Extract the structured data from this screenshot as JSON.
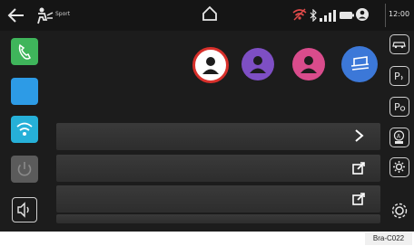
{
  "status_bar": {
    "drive_mode_label": "Sport",
    "time": "12:00",
    "icons": [
      "back-arrow-icon",
      "drive-mode-icon",
      "home-icon",
      "wifi-warning-icon",
      "bluetooth-icon",
      "signal-icon",
      "battery-icon",
      "user-icon"
    ]
  },
  "left_apps": [
    {
      "name": "phone-app-icon",
      "color": "#3fb55b"
    },
    {
      "name": "blank-app-icon",
      "color": "#2d9be6"
    },
    {
      "name": "wifi-app-icon",
      "color": "#26b0d8"
    },
    {
      "name": "power-app-icon",
      "color": "#5b5b5b"
    },
    {
      "name": "volume-icon",
      "color": "#cfcfcf"
    }
  ],
  "profiles": [
    {
      "name": "profile-1",
      "color": "#ffffff",
      "selected": true
    },
    {
      "name": "profile-2",
      "color": "#7e4fc4",
      "selected": false
    },
    {
      "name": "profile-3",
      "color": "#d94c8c",
      "selected": false
    },
    {
      "name": "profile-guest",
      "color": "#3c78d8",
      "selected": false
    }
  ],
  "right_icons": [
    "car-icon",
    "park-assist-icon",
    "park-view-icon",
    "auto-off-icon",
    "settings-small-icon",
    "gear-icon"
  ],
  "rows": [
    {
      "action": "chevron-right-icon"
    },
    {
      "action": "edit-icon"
    },
    {
      "action": "edit-icon"
    }
  ],
  "caption": "Bra-C022"
}
